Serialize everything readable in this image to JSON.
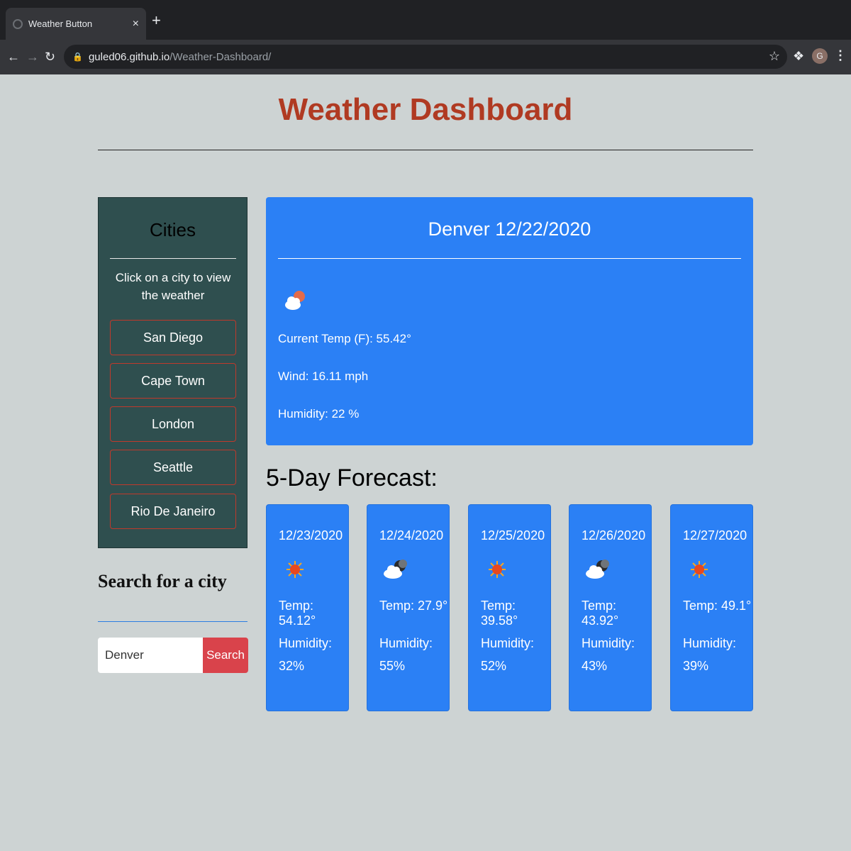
{
  "browser": {
    "tab_title": "Weather Button",
    "tab_close": "×",
    "new_tab": "+",
    "url_host": "guled06.github.io",
    "url_path": "/Weather-Dashboard/",
    "profile_initial": "G"
  },
  "header": {
    "title": "Weather Dashboard"
  },
  "sidebar": {
    "title": "Cities",
    "hint": "Click on a city to view the weather",
    "cities": [
      "San Diego",
      "Cape Town",
      "London",
      "Seattle",
      "Rio De Janeiro"
    ]
  },
  "search": {
    "title": "Search for a city",
    "input_value": "Denver",
    "button_label": "Search"
  },
  "current": {
    "title": "Denver 12/22/2020",
    "icon": "cloud-sun-icon",
    "temp": "Current Temp (F): 55.42°",
    "wind": "Wind: 16.11 mph",
    "humidity": "Humidity: 22 %"
  },
  "forecast": {
    "heading": "5-Day Forecast:",
    "days": [
      {
        "date": "12/23/2020",
        "icon": "sun-icon",
        "temp": "Temp: 54.12°",
        "humidity_label": "Humidity:",
        "humidity": "32%"
      },
      {
        "date": "12/24/2020",
        "icon": "cloud-moon-icon",
        "temp": "Temp: 27.9°",
        "humidity_label": "Humidity:",
        "humidity": "55%"
      },
      {
        "date": "12/25/2020",
        "icon": "sun-icon",
        "temp": "Temp: 39.58°",
        "humidity_label": "Humidity:",
        "humidity": "52%"
      },
      {
        "date": "12/26/2020",
        "icon": "cloud-moon-icon",
        "temp": "Temp: 43.92°",
        "humidity_label": "Humidity:",
        "humidity": "43%"
      },
      {
        "date": "12/27/2020",
        "icon": "sun-icon",
        "temp": "Temp: 49.1°",
        "humidity_label": "Humidity:",
        "humidity": "39%"
      }
    ]
  },
  "colors": {
    "title": "#b03a22",
    "card_blue": "#2b80f5",
    "sidebar_bg": "#2f4f4f",
    "search_button": "#d9434b",
    "city_border": "#c0392b"
  }
}
